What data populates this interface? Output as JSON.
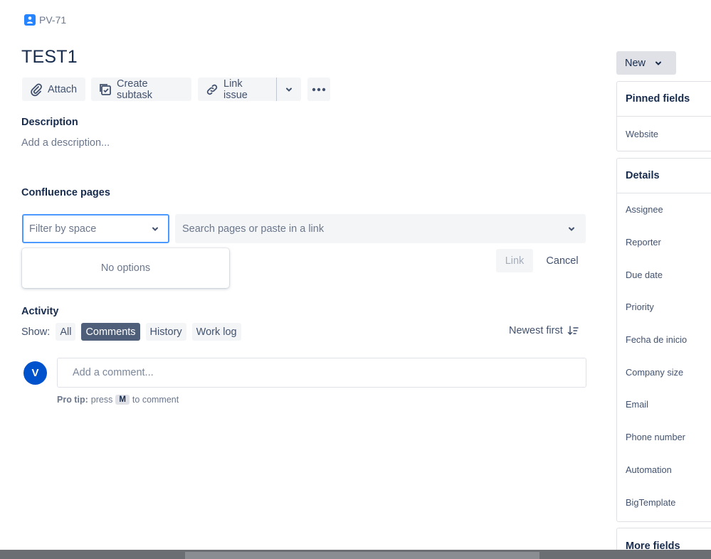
{
  "breadcrumb": {
    "issue_key": "PV-71"
  },
  "issue": {
    "title": "TEST1"
  },
  "toolbar": {
    "attach_label": "Attach",
    "create_subtask_label": "Create subtask",
    "link_issue_label": "Link issue"
  },
  "description": {
    "label": "Description",
    "placeholder": "Add a description..."
  },
  "confluence": {
    "label": "Confluence pages",
    "filter_placeholder": "Filter by space",
    "search_placeholder": "Search pages or paste in a link",
    "dropdown_empty": "No options",
    "link_label": "Link",
    "cancel_label": "Cancel"
  },
  "activity": {
    "label": "Activity",
    "show_label": "Show:",
    "filters": [
      "All",
      "Comments",
      "History",
      "Work log"
    ],
    "active_filter": "Comments",
    "sort_label": "Newest first",
    "avatar_initial": "V",
    "comment_placeholder": "Add a comment...",
    "protip_bold": "Pro tip:",
    "protip_press": "press",
    "protip_key": "M",
    "protip_after": "to comment"
  },
  "sidebar": {
    "status_button": "New",
    "pinned_title": "Pinned fields",
    "pinned_fields": [
      "Website"
    ],
    "details_title": "Details",
    "details_fields": [
      "Assignee",
      "Reporter",
      "Due date",
      "Priority",
      "Fecha de inicio",
      "Company size",
      "Email",
      "Phone number",
      "Automation",
      "BigTemplate"
    ],
    "more_fields_title": "More fields"
  },
  "colors": {
    "primary": "#0052cc",
    "focus_border": "#4c9aff",
    "active_pill": "#505f79",
    "text": "#172b4d",
    "muted": "#6b778c"
  }
}
